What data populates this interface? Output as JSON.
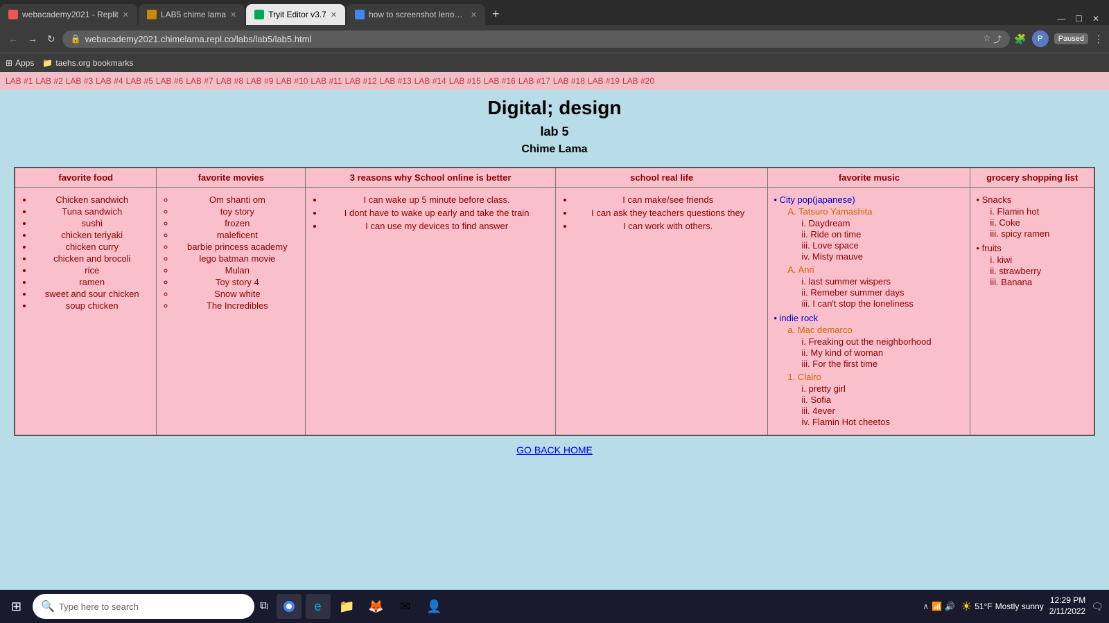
{
  "browser": {
    "tabs": [
      {
        "id": "tab1",
        "title": "webacademy2021 - Replit",
        "favicon_color": "#e55",
        "active": false
      },
      {
        "id": "tab2",
        "title": "LAB5 chime lama",
        "favicon_color": "#cc8800",
        "active": false
      },
      {
        "id": "tab3",
        "title": "Tryit Editor v3.7",
        "favicon_color": "#00aa55",
        "active": true
      },
      {
        "id": "tab4",
        "title": "how to screenshot lenovo - Goo...",
        "favicon_color": "#4285f4",
        "active": false
      }
    ],
    "address": "webacademy2021.chimelama.repl.co/labs/lab5/lab5.html",
    "profile_label": "P",
    "paused_label": "Paused"
  },
  "bookmarks": [
    {
      "label": "Apps",
      "icon": "⊞"
    },
    {
      "label": "taehs.org bookmarks"
    }
  ],
  "lab_nav": {
    "labs": [
      "LAB #1",
      "LAB #2",
      "LAB #3",
      "LAB #4",
      "LAB #5",
      "LAB #6",
      "LAB #7",
      "LAB #8",
      "LAB #9",
      "LAB #10",
      "LAB #11",
      "LAB #12",
      "LAB #13",
      "LAB #14",
      "LAB #15",
      "LAB #16",
      "LAB #17",
      "LAB #18",
      "LAB #19",
      "LAB #20"
    ]
  },
  "page": {
    "title": "Digital; design",
    "subtitle": "lab 5",
    "author": "Chime Lama"
  },
  "table": {
    "headers": [
      "favorite food",
      "favorite movies",
      "3 reasons why School online is better",
      "school real life",
      "favorite music",
      "grocery shopping list"
    ],
    "food": {
      "items": [
        "Chicken sandwich",
        "Tuna sandwich",
        "sushi",
        "chicken teriyaki",
        "chicken curry",
        "chicken and brocoli",
        "rice",
        "ramen",
        "sweet and sour chicken",
        "soup chicken"
      ]
    },
    "movies": {
      "items": [
        "Om shanti om",
        "toy story",
        "frozen",
        "maleficent",
        "barbie princess academy",
        "lego batman movie",
        "Mulan",
        "Toy story 4",
        "Snow white",
        "The Incredibles"
      ]
    },
    "reasons": {
      "items": [
        "I can wake up 5 minute before class.",
        "I dont have to wake up early and take the train",
        "I can use my devices to find answer"
      ]
    },
    "real_life": {
      "items": [
        "I can make/see friends",
        "I can ask they teachers questions they",
        "I can work with others."
      ]
    },
    "music": {
      "genre1": "City pop(japanese)",
      "artist1": "A. Tatsuro Yamashita",
      "songs1": [
        "i. Daydream",
        "ii. Ride on time",
        "iii. Love space",
        "iv. Misty mauve"
      ],
      "artist2": "A. Anri",
      "songs2": [
        "i. last summer wispers",
        "ii. Remeber summer days",
        "iii. I can't stop the loneliness"
      ],
      "genre2": "indie rock",
      "artist3": "a. Mac demarco",
      "songs3": [
        "i. Freaking out the neighborhood",
        "ii. My kind of woman",
        "iii. For the first time"
      ],
      "artist4": "1. Clairo",
      "songs4": [
        "i. pretty girl",
        "ii. Sofia",
        "iii. 4ever",
        "iv. Flamin Hot cheetos"
      ]
    },
    "grocery": {
      "snacks_label": "Snacks",
      "snacks": [
        "i. Flamin hot",
        "ii. Coke",
        "iii. spicy ramen"
      ],
      "fruits_label": "fruits",
      "fruits": [
        "i. kiwi",
        "ii. strawberry",
        "iii. Banana"
      ]
    }
  },
  "back_link": "GO BACK HOME",
  "taskbar": {
    "search_placeholder": "Type here to search",
    "weather_temp": "51°F",
    "weather_desc": "Mostly sunny",
    "time": "12:29 PM",
    "date": "2/11/2022"
  }
}
